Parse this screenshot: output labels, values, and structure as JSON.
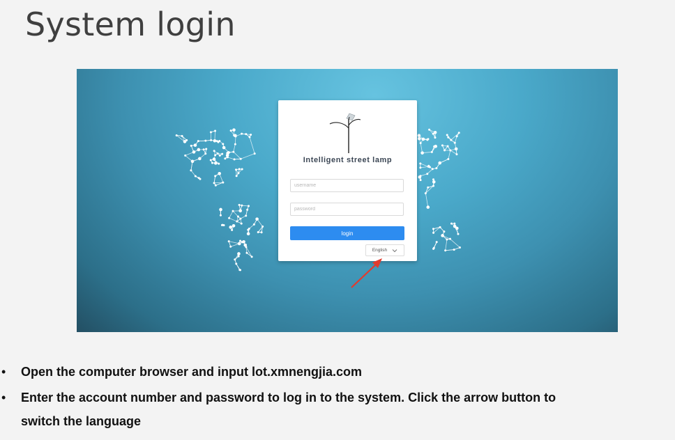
{
  "slide": {
    "title": "System login"
  },
  "login_page": {
    "app_name": "Intelligent street lamp",
    "username_placeholder": "username",
    "password_placeholder": "password",
    "login_label": "login",
    "language": "English",
    "accent_color": "#2d8cf0",
    "annotation_arrow_color": "#e23b2e"
  },
  "bullets": [
    "Open the computer browser and input lot.xmnengjia.com",
    "Enter the account number and password to log in to the system. Click the arrow button to",
    "switch the language"
  ]
}
